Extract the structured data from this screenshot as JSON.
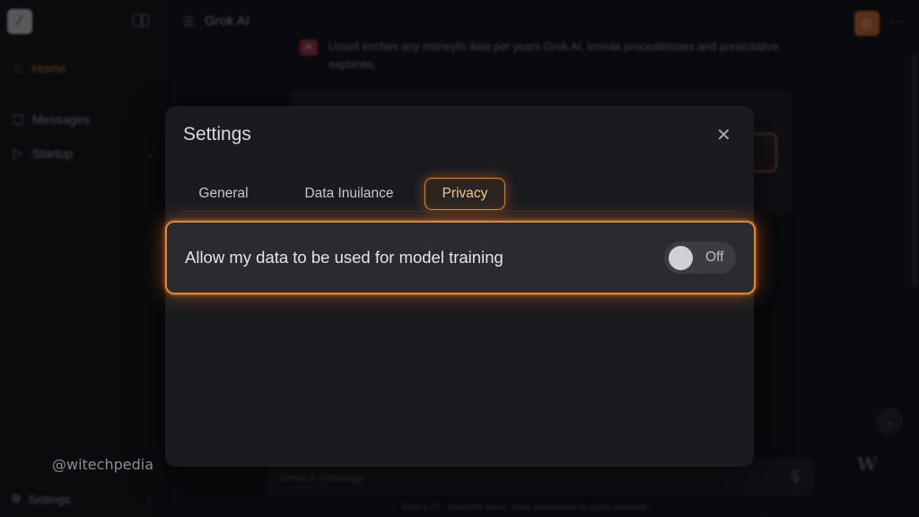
{
  "app": {
    "title": "Grok AI",
    "logo_glyph": "⁄",
    "avatar_initial": "G"
  },
  "sidebar": {
    "items": [
      {
        "label": "Home",
        "icon": "home-icon",
        "active": true
      },
      {
        "label": "Messages",
        "icon": "chat-bubble-icon"
      },
      {
        "label": "Startup",
        "icon": "play-icon",
        "has_chevron": true
      }
    ],
    "settings_label": "Settings"
  },
  "chat": {
    "message": "Ussell enches any moneyfo data per years Grok AI, tomida proceattimaes and presicitative explanes.",
    "composer_placeholder": "Send a message",
    "footnote": "Grok 4.70 · Nassoffia Nerre, shink moradened ifo rights reserved."
  },
  "modal": {
    "title": "Settings",
    "tabs": [
      {
        "label": "General"
      },
      {
        "label": "Data Inuilance"
      },
      {
        "label": "Privacy",
        "active": true
      }
    ],
    "setting": {
      "label": "Allow my data to be used for model training",
      "toggle_state": "Off"
    }
  },
  "watermark": {
    "text": "@witechpedia"
  },
  "colors": {
    "accent": "#ec7a2f",
    "background": "#0c0d10",
    "modal": "#1a1b1f"
  }
}
